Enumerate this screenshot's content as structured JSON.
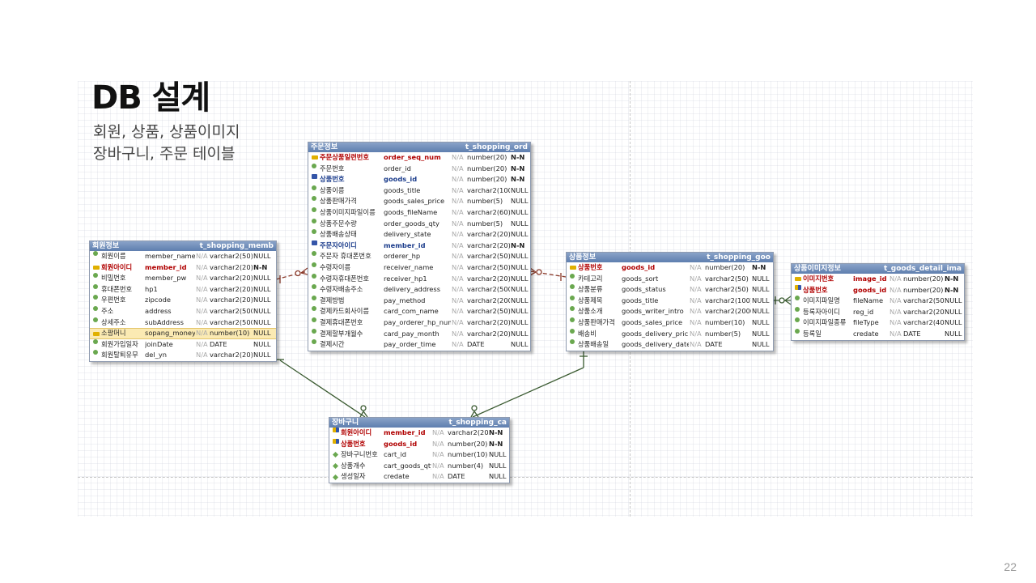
{
  "title": "DB 설계",
  "subtitle": [
    "회원, 상품, 상품이미지",
    "장바구니, 주문 테이블"
  ],
  "page_number": "22",
  "tables": {
    "member": {
      "kname": "회원정보",
      "ename": "t_shopping_memb",
      "rows": [
        {
          "icon": "dot",
          "k": "회원이름",
          "e": "member_name",
          "na": "N/A",
          "t": "varchar2(50)",
          "n": "NULL"
        },
        {
          "icon": "key",
          "k": "회원아이디",
          "e": "member_id",
          "na": "N/A",
          "t": "varchar2(20)",
          "n": "N-N",
          "pk": true
        },
        {
          "icon": "dot",
          "k": "비밀번호",
          "e": "member_pw",
          "na": "N/A",
          "t": "varchar2(20)",
          "n": "NULL"
        },
        {
          "icon": "dot",
          "k": "휴대폰번호",
          "e": "hp1",
          "na": "N/A",
          "t": "varchar2(20)",
          "n": "NULL"
        },
        {
          "icon": "dot",
          "k": "우편번호",
          "e": "zipcode",
          "na": "N/A",
          "t": "varchar2(20)",
          "n": "NULL"
        },
        {
          "icon": "dot",
          "k": "주소",
          "e": "address",
          "na": "N/A",
          "t": "varchar2(500)",
          "n": "NULL"
        },
        {
          "icon": "dot",
          "k": "상세주소",
          "e": "subAddress",
          "na": "N/A",
          "t": "varchar2(500)",
          "n": "NULL"
        },
        {
          "icon": "key",
          "k": "소팡머니",
          "e": "sopang_money",
          "na": "N/A",
          "t": "number(10)",
          "n": "NULL",
          "hl": true
        },
        {
          "icon": "dot",
          "k": "회원가입일자",
          "e": "joinDate",
          "na": "N/A",
          "t": "DATE",
          "n": "NULL"
        },
        {
          "icon": "dot",
          "k": "회원탈퇴유무",
          "e": "del_yn",
          "na": "N/A",
          "t": "varchar2(20)",
          "n": "NULL"
        }
      ]
    },
    "order": {
      "kname": "주문정보",
      "ename": "t_shopping_ord",
      "rows": [
        {
          "icon": "key",
          "k": "주문상품일련번호",
          "e": "order_seq_num",
          "na": "N/A",
          "t": "number(20)",
          "n": "N-N",
          "pk": true
        },
        {
          "icon": "dot",
          "k": "주문번호",
          "e": "order_id",
          "na": "N/A",
          "t": "number(20)",
          "n": "N-N"
        },
        {
          "icon": "fk",
          "k": "상품번호",
          "e": "goods_id",
          "na": "N/A",
          "t": "number(20)",
          "n": "N-N",
          "fk": true
        },
        {
          "icon": "dot",
          "k": "상품이름",
          "e": "goods_title",
          "na": "N/A",
          "t": "varchar2(100)",
          "n": "NULL"
        },
        {
          "icon": "dot",
          "k": "상품판매가격",
          "e": "goods_sales_price",
          "na": "N/A",
          "t": "number(5)",
          "n": "NULL"
        },
        {
          "icon": "dot",
          "k": "상품이미지파일이름",
          "e": "goods_fileName",
          "na": "N/A",
          "t": "varchar2(60)",
          "n": "NULL"
        },
        {
          "icon": "dot",
          "k": "상품주문수량",
          "e": "order_goods_qty",
          "na": "N/A",
          "t": "number(5)",
          "n": "NULL"
        },
        {
          "icon": "dot",
          "k": "상품배송상태",
          "e": "delivery_state",
          "na": "N/A",
          "t": "varchar2(20)",
          "n": "NULL"
        },
        {
          "icon": "fk",
          "k": "주문자아이디",
          "e": "member_id",
          "na": "N/A",
          "t": "varchar2(20)",
          "n": "N-N",
          "fk": true
        },
        {
          "icon": "dot",
          "k": "주문자 휴대폰번호",
          "e": "orderer_hp",
          "na": "N/A",
          "t": "varchar2(50)",
          "n": "NULL"
        },
        {
          "icon": "dot",
          "k": "수령자이름",
          "e": "receiver_name",
          "na": "N/A",
          "t": "varchar2(50)",
          "n": "NULL"
        },
        {
          "icon": "dot",
          "k": "수령자휴대폰번호",
          "e": "receiver_hp1",
          "na": "N/A",
          "t": "varchar2(20)",
          "n": "NULL"
        },
        {
          "icon": "dot",
          "k": "수령자배송주소",
          "e": "delivery_address",
          "na": "N/A",
          "t": "varchar2(500)",
          "n": "NULL"
        },
        {
          "icon": "dot",
          "k": "결제방법",
          "e": "pay_method",
          "na": "N/A",
          "t": "varchar2(200)",
          "n": "NULL"
        },
        {
          "icon": "dot",
          "k": "결제카드회사이름",
          "e": "card_com_name",
          "na": "N/A",
          "t": "varchar2(50)",
          "n": "NULL"
        },
        {
          "icon": "dot",
          "k": "결제휴대폰번호",
          "e": "pay_orderer_hp_num",
          "na": "N/A",
          "t": "varchar2(20)",
          "n": "NULL"
        },
        {
          "icon": "dot",
          "k": "결제할부개월수",
          "e": "card_pay_month",
          "na": "N/A",
          "t": "varchar2(20)",
          "n": "NULL"
        },
        {
          "icon": "dot",
          "k": "결제시간",
          "e": "pay_order_time",
          "na": "N/A",
          "t": "DATE",
          "n": "NULL"
        }
      ]
    },
    "goods": {
      "kname": "상품정보",
      "ename": "t_shopping_goo",
      "rows": [
        {
          "icon": "key",
          "k": "상품번호",
          "e": "goods_id",
          "na": "N/A",
          "t": "number(20)",
          "n": "N-N",
          "pk": true
        },
        {
          "icon": "dot",
          "k": "카테고리",
          "e": "goods_sort",
          "na": "N/A",
          "t": "varchar2(50)",
          "n": "NULL"
        },
        {
          "icon": "dot",
          "k": "상품분류",
          "e": "goods_status",
          "na": "N/A",
          "t": "varchar2(50)",
          "n": "NULL"
        },
        {
          "icon": "dot",
          "k": "상품제목",
          "e": "goods_title",
          "na": "N/A",
          "t": "varchar2(100)",
          "n": "NULL"
        },
        {
          "icon": "dot",
          "k": "상품소개",
          "e": "goods_writer_intro",
          "na": "N/A",
          "t": "varchar2(2000)",
          "n": "NULL"
        },
        {
          "icon": "dot",
          "k": "상품판매가격",
          "e": "goods_sales_price",
          "na": "N/A",
          "t": "number(10)",
          "n": "NULL"
        },
        {
          "icon": "dot",
          "k": "배송비",
          "e": "goods_delivery_pric",
          "na": "N/A",
          "t": "number(5)",
          "n": "NULL"
        },
        {
          "icon": "dot",
          "k": "상품배송일",
          "e": "goods_delivery_date",
          "na": "N/A",
          "t": "DATE",
          "n": "NULL"
        }
      ]
    },
    "image": {
      "kname": "상품이미지정보",
      "ename": "t_goods_detail_ima",
      "rows": [
        {
          "icon": "key",
          "k": "이미지번호",
          "e": "image_id",
          "na": "N/A",
          "t": "number(20)",
          "n": "N-N",
          "pk": true
        },
        {
          "icon": "pfk",
          "k": "상품번호",
          "e": "goods_id",
          "na": "N/A",
          "t": "number(20)",
          "n": "N-N",
          "pk": true
        },
        {
          "icon": "dot",
          "k": "이미지파일명",
          "e": "fileName",
          "na": "N/A",
          "t": "varchar2(50)",
          "n": "NULL"
        },
        {
          "icon": "dot",
          "k": "등록자아이디",
          "e": "reg_id",
          "na": "N/A",
          "t": "varchar2(20)",
          "n": "NULL"
        },
        {
          "icon": "dot",
          "k": "이미지파일종류",
          "e": "fileType",
          "na": "N/A",
          "t": "varchar2(40)",
          "n": "NULL"
        },
        {
          "icon": "dot",
          "k": "등록일",
          "e": "credate",
          "na": "N/A",
          "t": "DATE",
          "n": "NULL"
        }
      ]
    },
    "cart": {
      "kname": "장바구니",
      "ename": "t_shopping_ca",
      "rows": [
        {
          "icon": "pfk",
          "k": "회원아이디",
          "e": "member_id",
          "na": "N/A",
          "t": "varchar2(20)",
          "n": "N-N",
          "pk": true
        },
        {
          "icon": "pfk",
          "k": "상품번호",
          "e": "goods_id",
          "na": "N/A",
          "t": "number(20)",
          "n": "N-N",
          "pk": true
        },
        {
          "icon": "dia",
          "k": "장바구니번호",
          "e": "cart_id",
          "na": "N/A",
          "t": "number(10)",
          "n": "NULL"
        },
        {
          "icon": "dia",
          "k": "상품개수",
          "e": "cart_goods_qty",
          "na": "N/A",
          "t": "number(4)",
          "n": "NULL"
        },
        {
          "icon": "dia",
          "k": "생성일자",
          "e": "credate",
          "na": "N/A",
          "t": "DATE",
          "n": "NULL"
        }
      ]
    }
  }
}
